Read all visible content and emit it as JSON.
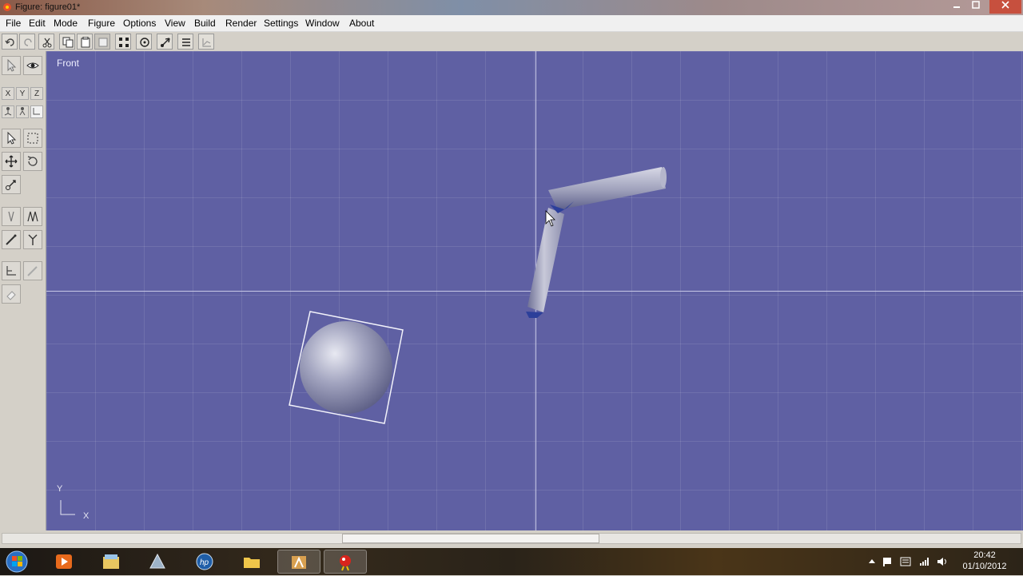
{
  "window": {
    "title": "Figure: figure01*",
    "controls": [
      "minimize-icon",
      "maximize-icon",
      "close-icon"
    ]
  },
  "menu": [
    "File",
    "Edit",
    "Mode",
    "Figure",
    "Options",
    "View",
    "Build",
    "Render",
    "Settings",
    "Window",
    "About"
  ],
  "toolbar": {
    "buttons": [
      "undo-icon",
      "redo-icon",
      "cut-icon",
      "copy-icon",
      "paste-icon",
      "duplicate-icon",
      "grid-points-icon",
      "rotate-joint-icon",
      "move-joint-icon",
      "list-icon",
      "graph-icon"
    ]
  },
  "tools": {
    "axes": [
      "X",
      "Y",
      "Z"
    ],
    "icons": [
      "select-arrow-icon",
      "eye-icon",
      "arrow-select-icon",
      "box-select-icon",
      "move-icon",
      "rotate-icon",
      "scale-icon",
      "bone-icon",
      "multi-bone-icon",
      "brush-icon",
      "joint-icon",
      "angle-icon",
      "pencil-icon",
      "eraser-icon"
    ]
  },
  "viewport": {
    "view_name": "Front",
    "axis_y_label": "Y",
    "axis_x_label": "X",
    "background_color": "#5f60a3",
    "objects": [
      "sphere",
      "bent-cylinder-arm"
    ]
  },
  "scrollbar": {
    "position": 0.35
  },
  "taskbar": {
    "apps": [
      "start-icon",
      "media-player-icon",
      "file-explorer-icon",
      "app-icon",
      "hp-icon",
      "folder-icon",
      "figure-editor-icon",
      "bird-app-icon"
    ],
    "clock_time": "20:42",
    "clock_date": "01/10/2012"
  }
}
